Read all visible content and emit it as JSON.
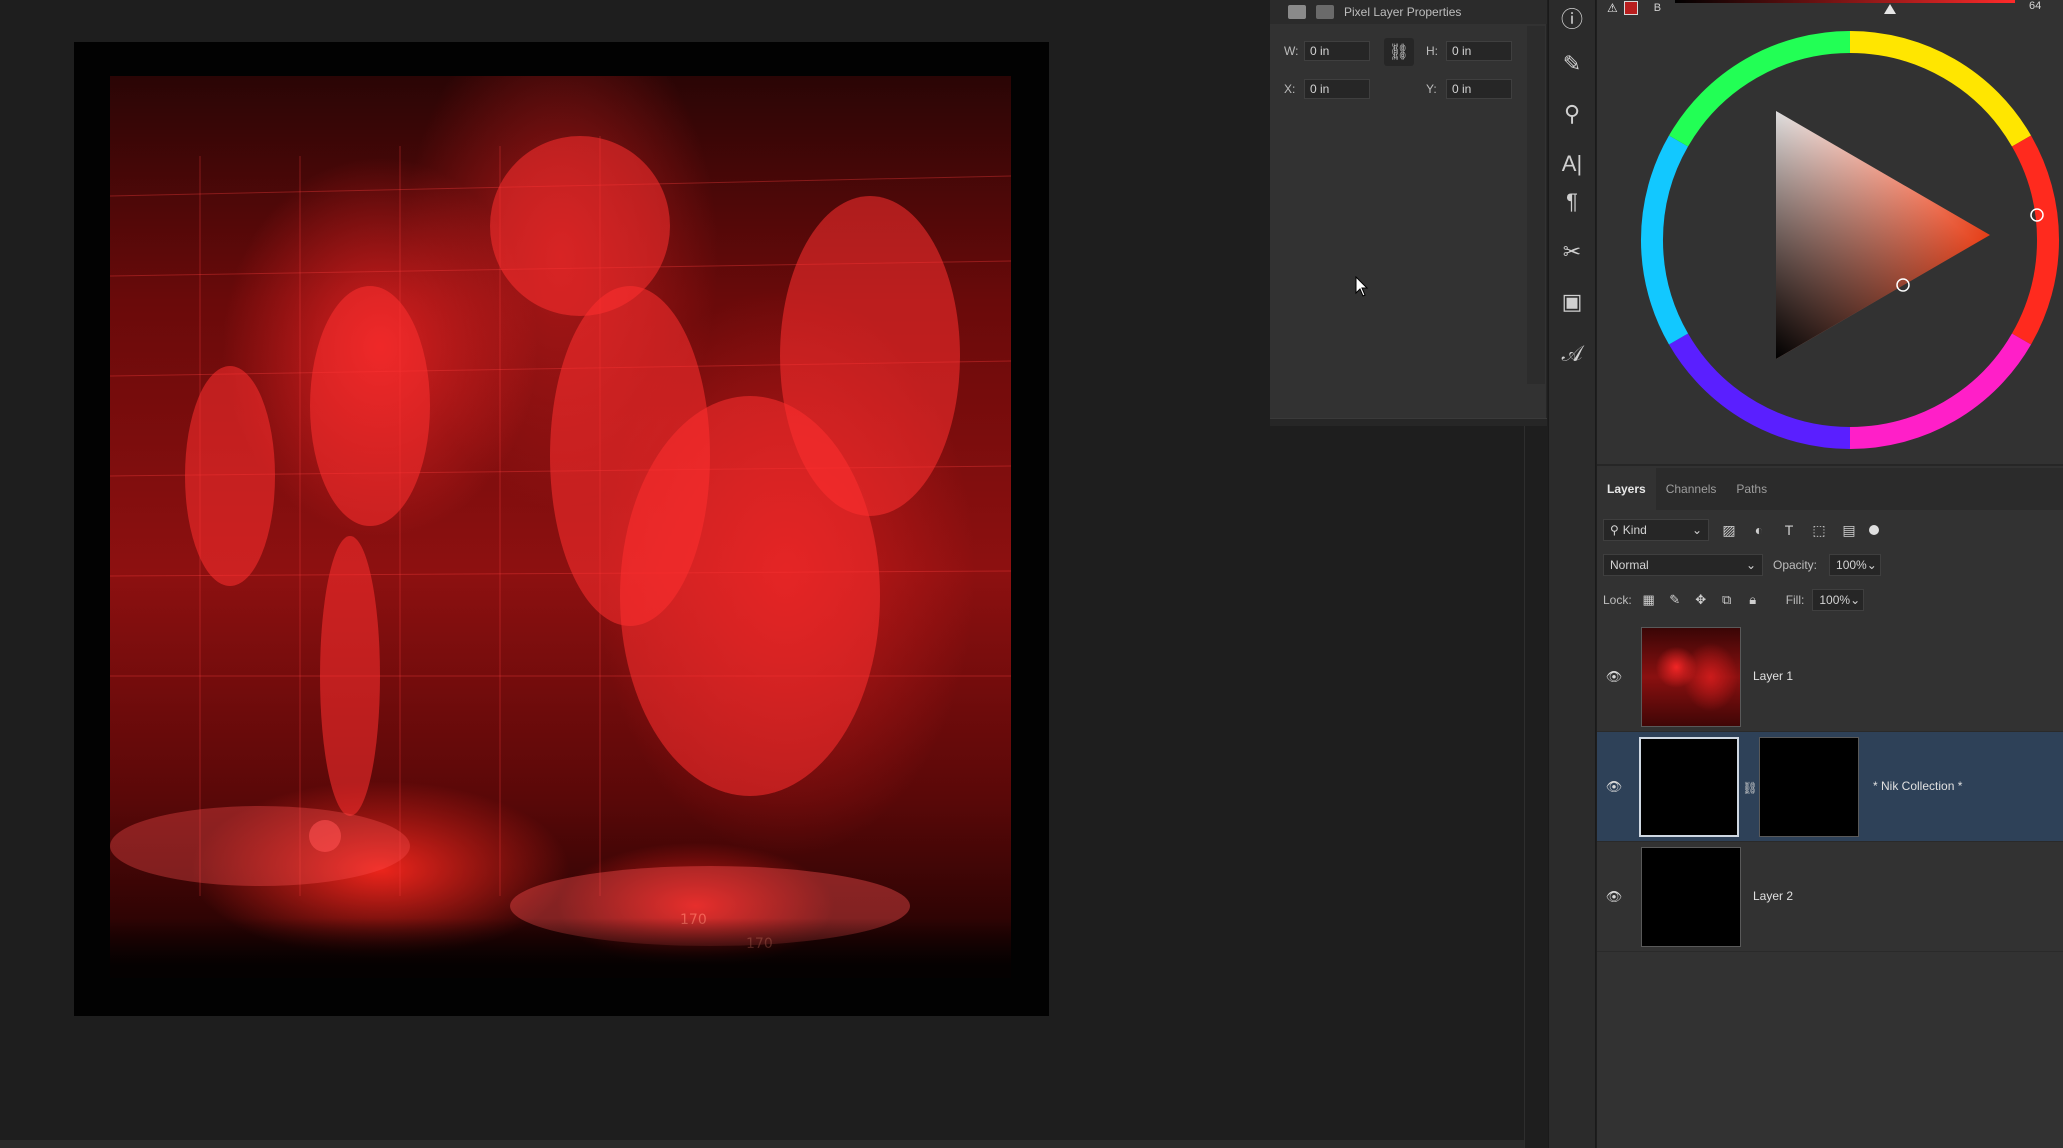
{
  "properties": {
    "title": "Pixel Layer Properties",
    "w_label": "W:",
    "w_value": "0 in",
    "h_label": "H:",
    "h_value": "0 in",
    "x_label": "X:",
    "x_value": "0 in",
    "y_label": "Y:",
    "y_value": "0 in"
  },
  "color": {
    "channel_label": "B",
    "channel_value": "64",
    "foreground": "#b81e1e"
  },
  "tools": [
    {
      "name": "info-icon",
      "glyph": "ⓘ"
    },
    {
      "name": "brush-settings-icon",
      "glyph": "✎"
    },
    {
      "name": "clone-source-icon",
      "glyph": "⚲"
    },
    {
      "name": "character-icon",
      "glyph": "A|"
    },
    {
      "name": "paragraph-icon",
      "glyph": "¶"
    },
    {
      "name": "tool-presets-icon",
      "glyph": "✂"
    },
    {
      "name": "libraries-icon",
      "glyph": "▣"
    },
    {
      "name": "glyphs-icon",
      "glyph": "𝒜"
    }
  ],
  "layers_panel": {
    "tabs": [
      "Layers",
      "Channels",
      "Paths"
    ],
    "kind_label": "Kind",
    "blend_mode": "Normal",
    "opacity_label": "Opacity:",
    "opacity_value": "100%",
    "lock_label": "Lock:",
    "fill_label": "Fill:",
    "fill_value": "100%",
    "layers": [
      {
        "name": "Layer 1",
        "visible": true,
        "selected": false
      },
      {
        "name": "* Nik Collection *",
        "visible": true,
        "selected": true,
        "has_mask": true
      },
      {
        "name": "Layer 2",
        "visible": true,
        "selected": false
      }
    ]
  }
}
